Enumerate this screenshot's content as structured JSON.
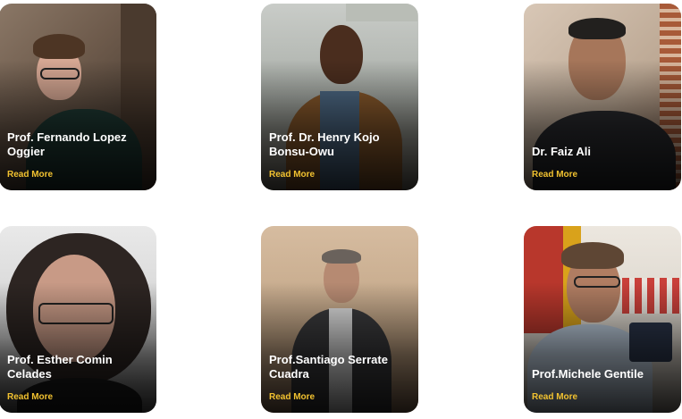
{
  "cards": [
    {
      "name": "Prof. Fernando Lopez Oggier",
      "link": "Read More"
    },
    {
      "name": "Prof. Dr. Henry Kojo Bonsu-Owu",
      "link": "Read More"
    },
    {
      "name": "Dr. Faiz Ali",
      "link": "Read More"
    },
    {
      "name": "Prof. Esther Comin Celades",
      "link": "Read More"
    },
    {
      "name": "Prof.Santiago Serrate Cuadra",
      "link": "Read More"
    },
    {
      "name": "Prof.Michele Gentile",
      "link": "Read More"
    }
  ],
  "colors": {
    "name_text": "#ffffff",
    "link_text": "#f2c230"
  }
}
